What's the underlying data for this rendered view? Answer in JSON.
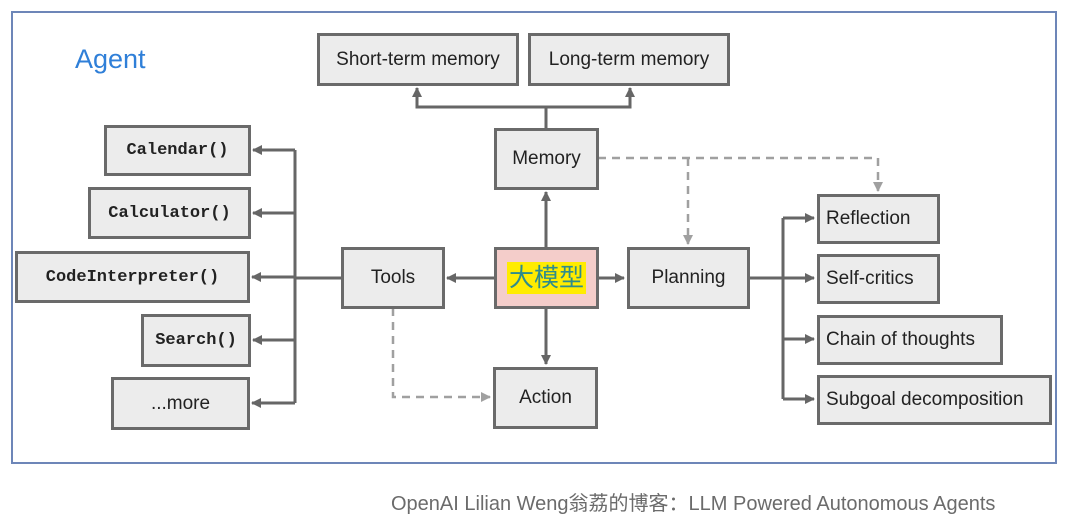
{
  "diagram": {
    "title": "Agent",
    "core": {
      "label": "大模型",
      "highlight_color": "#ffec00",
      "fill_color": "#f4cdca"
    },
    "memory": {
      "label": "Memory",
      "children": [
        "Short-term memory",
        "Long-term memory"
      ]
    },
    "tools": {
      "label": "Tools",
      "children": [
        "Calendar()",
        "Calculator()",
        "CodeInterpreter()",
        "Search()",
        "...more"
      ]
    },
    "planning": {
      "label": "Planning",
      "children": [
        "Reflection",
        "Self-critics",
        "Chain of thoughts",
        "Subgoal decomposition"
      ]
    },
    "action": {
      "label": "Action"
    },
    "edges": [
      {
        "from": "大模型",
        "to": "Memory",
        "style": "solid"
      },
      {
        "from": "大模型",
        "to": "Tools",
        "style": "solid"
      },
      {
        "from": "大模型",
        "to": "Planning",
        "style": "solid"
      },
      {
        "from": "大模型",
        "to": "Action",
        "style": "solid"
      },
      {
        "from": "Memory",
        "to": "Short-term memory",
        "style": "solid"
      },
      {
        "from": "Memory",
        "to": "Long-term memory",
        "style": "solid"
      },
      {
        "from": "Memory",
        "to": "Planning",
        "style": "dashed"
      },
      {
        "from": "Memory",
        "to": "Reflection",
        "style": "dashed"
      },
      {
        "from": "Tools",
        "to": "Action",
        "style": "dashed"
      },
      {
        "from": "Tools",
        "to": "Calendar()",
        "style": "solid"
      },
      {
        "from": "Tools",
        "to": "Calculator()",
        "style": "solid"
      },
      {
        "from": "Tools",
        "to": "CodeInterpreter()",
        "style": "solid"
      },
      {
        "from": "Tools",
        "to": "Search()",
        "style": "solid"
      },
      {
        "from": "Tools",
        "to": "...more",
        "style": "solid"
      },
      {
        "from": "Planning",
        "to": "Reflection",
        "style": "solid"
      },
      {
        "from": "Planning",
        "to": "Self-critics",
        "style": "solid"
      },
      {
        "from": "Planning",
        "to": "Chain of thoughts",
        "style": "solid"
      },
      {
        "from": "Planning",
        "to": "Subgoal decomposition",
        "style": "solid"
      }
    ],
    "colors": {
      "frame": "#6d86b8",
      "title": "#2f7fd8",
      "line": "#666666",
      "dashed": "#a0a0a0",
      "box_fill": "#ececec"
    }
  },
  "caption": "OpenAI Lilian Weng翁荔的博客：LLM Powered Autonomous Agents"
}
